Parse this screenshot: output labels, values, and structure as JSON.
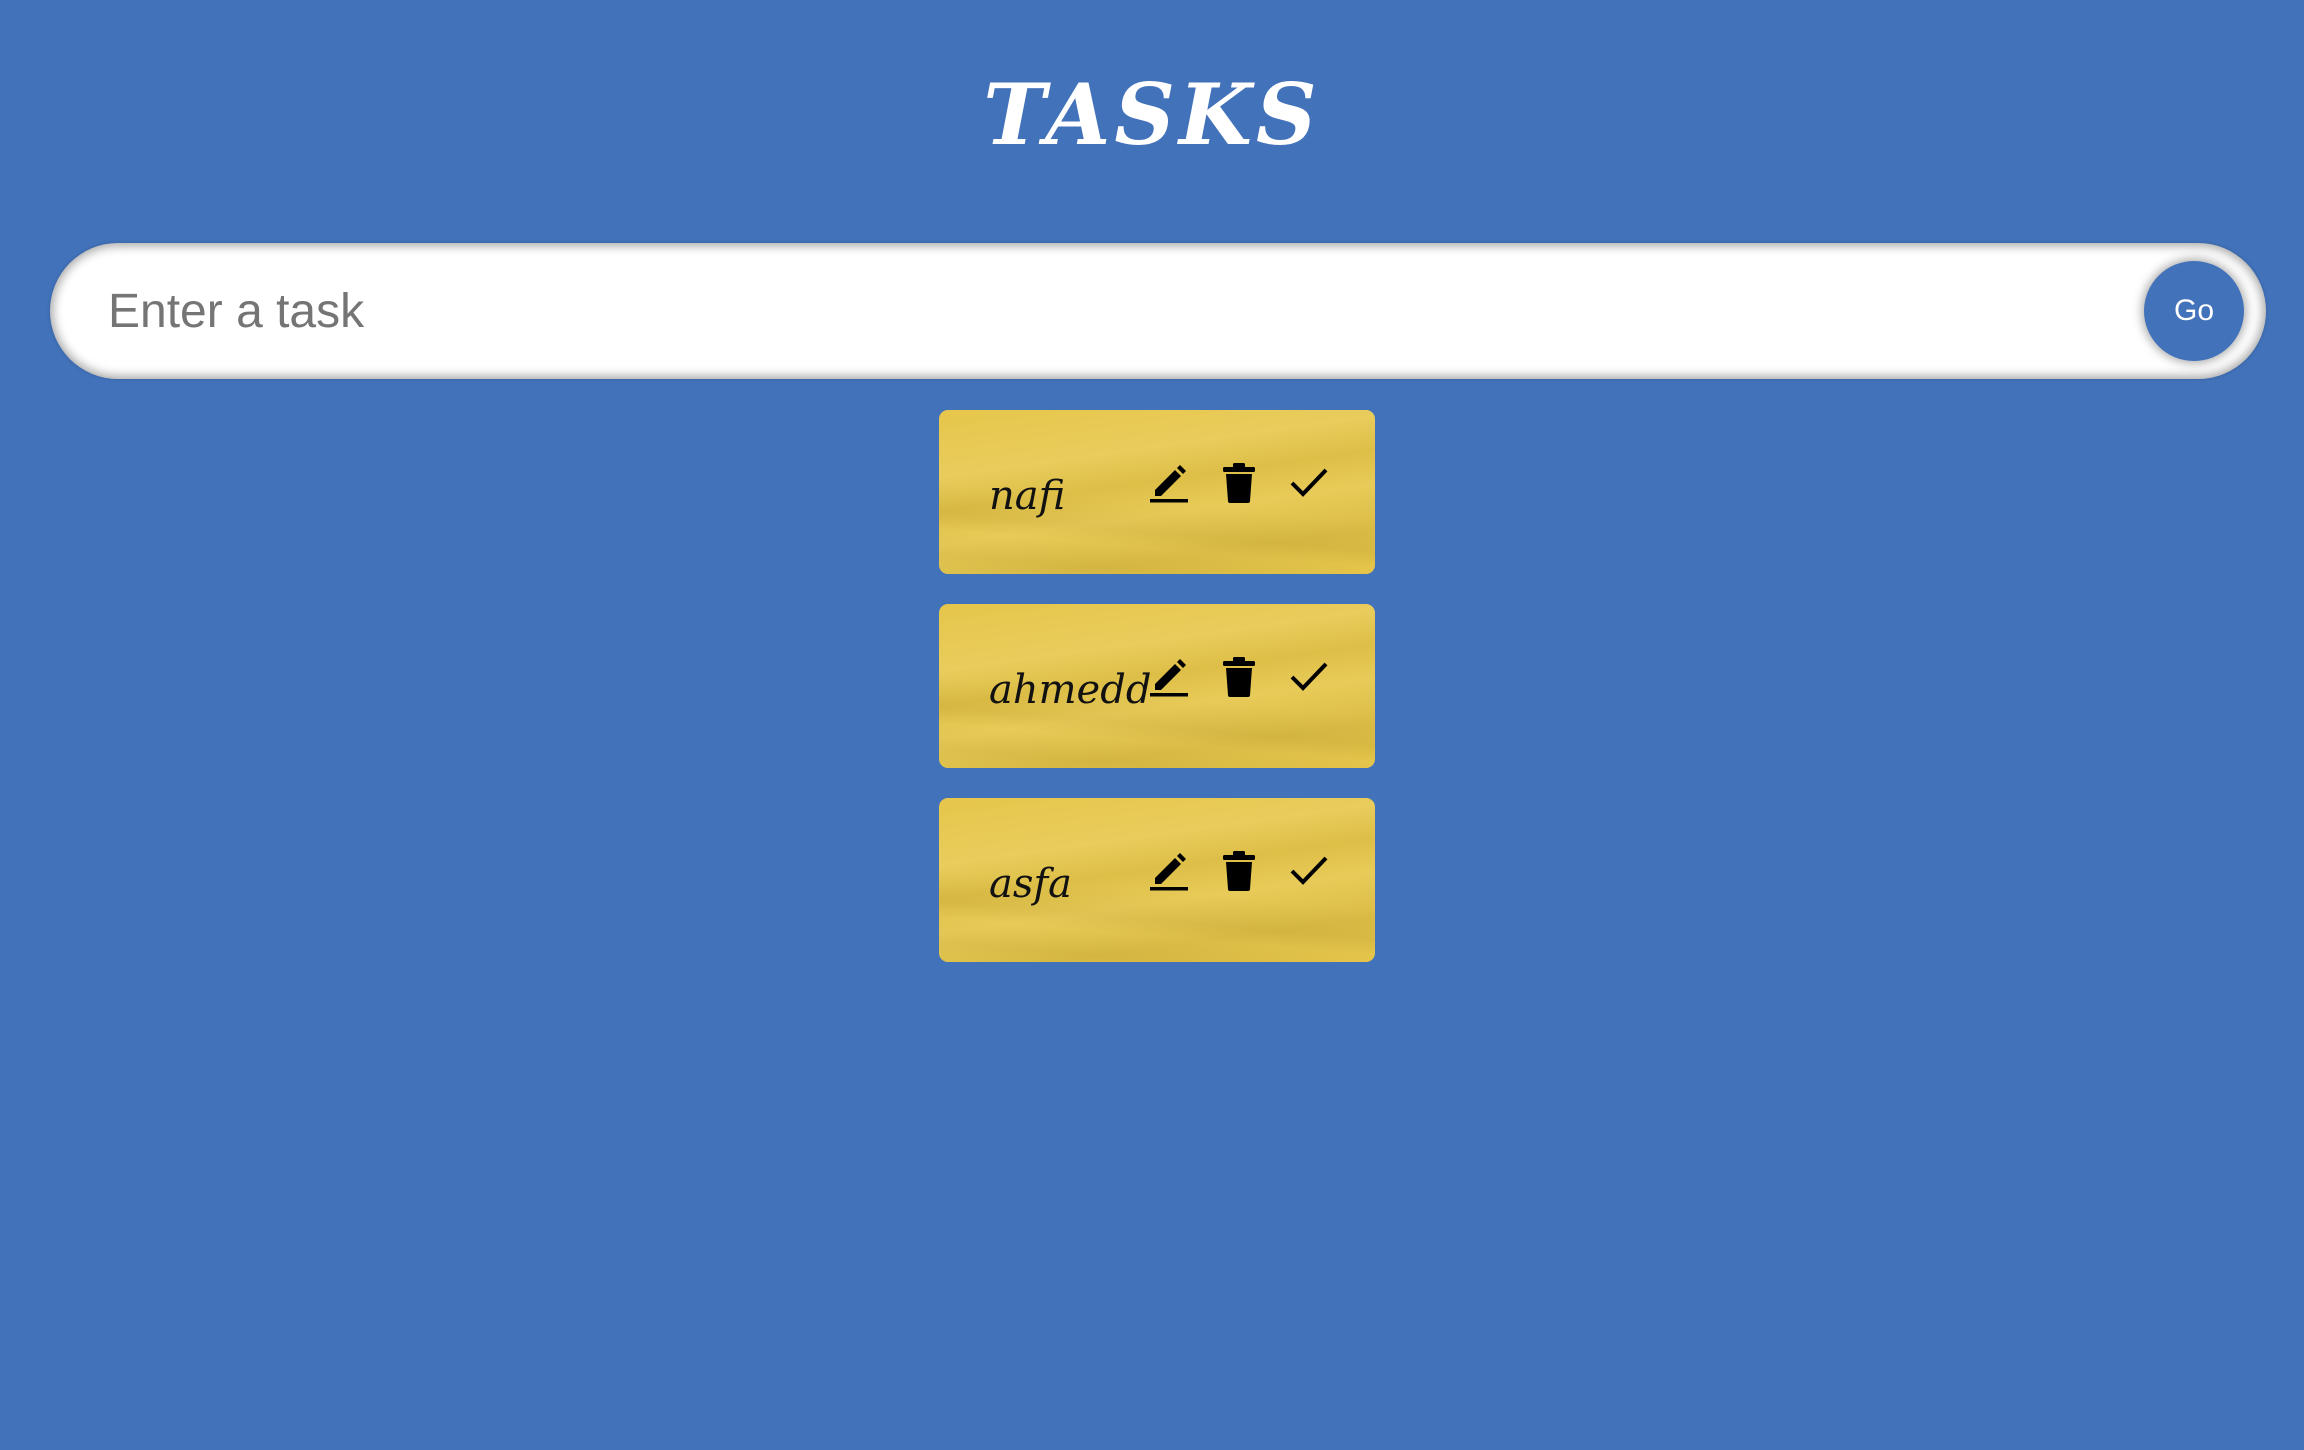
{
  "header": {
    "title": "TASKS"
  },
  "form": {
    "placeholder": "Enter a task",
    "value": "",
    "go_label": "Go"
  },
  "tasks": [
    {
      "text": "nafi"
    },
    {
      "text": "ahmedd"
    },
    {
      "text": "asfa"
    }
  ],
  "icons": {
    "edit": "pencil-icon",
    "delete": "trash-icon",
    "complete": "check-icon"
  },
  "colors": {
    "background": "#4272ba",
    "card": "#e6c64a",
    "button": "#4272ba",
    "text_on_bg": "#ffffff"
  }
}
